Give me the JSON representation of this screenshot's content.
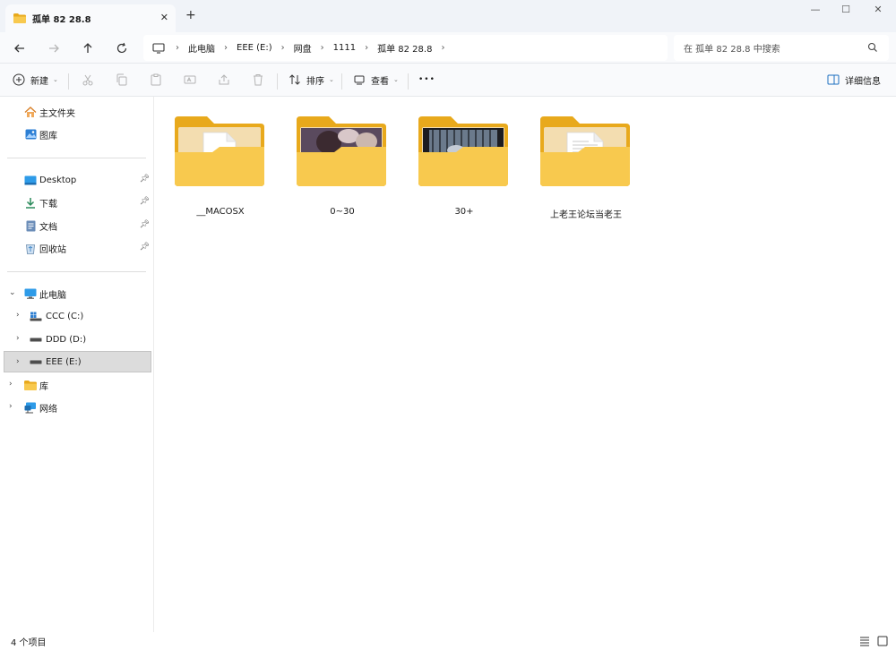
{
  "tab": {
    "title": "孤单 82 28.8",
    "close": "✕",
    "new_tab": "+"
  },
  "window_controls": {
    "minimize": "—",
    "maximize": "☐",
    "close": "✕"
  },
  "breadcrumb": [
    "此电脑",
    "EEE (E:)",
    "网盘",
    "1111",
    "孤单 82 28.8"
  ],
  "search": {
    "placeholder": "在 孤单 82 28.8 中搜索"
  },
  "toolbar": {
    "new_label": "新建",
    "sort_label": "排序",
    "view_label": "查看",
    "more_label": "•••",
    "details_label": "详细信息"
  },
  "sidebar": {
    "quick": [
      {
        "label": "主文件夹",
        "icon": "home-icon"
      },
      {
        "label": "图库",
        "icon": "gallery-icon"
      }
    ],
    "pinned": [
      {
        "label": "Desktop",
        "icon": "desktop-icon"
      },
      {
        "label": "下载",
        "icon": "download-icon"
      },
      {
        "label": "文档",
        "icon": "document-icon"
      },
      {
        "label": "回收站",
        "icon": "recycle-bin-icon"
      }
    ],
    "this_pc": {
      "label": "此电脑"
    },
    "drives": [
      {
        "label": "CCC (C:)"
      },
      {
        "label": "DDD (D:)"
      },
      {
        "label": "EEE (E:)",
        "selected": true
      }
    ],
    "library": {
      "label": "库"
    },
    "network": {
      "label": "网络"
    }
  },
  "files": [
    {
      "name": "__MACOSX",
      "kind": "folder-doc"
    },
    {
      "name": "0~30",
      "kind": "folder-photo"
    },
    {
      "name": "30+",
      "kind": "folder-photo"
    },
    {
      "name": "上老王论坛当老王",
      "kind": "folder-doc"
    }
  ],
  "status": {
    "count": "4 个项目"
  },
  "colors": {
    "folder_back": "#e8a91c",
    "folder_front": "#f8c94e",
    "selected_bg": "#dcdcdc"
  }
}
